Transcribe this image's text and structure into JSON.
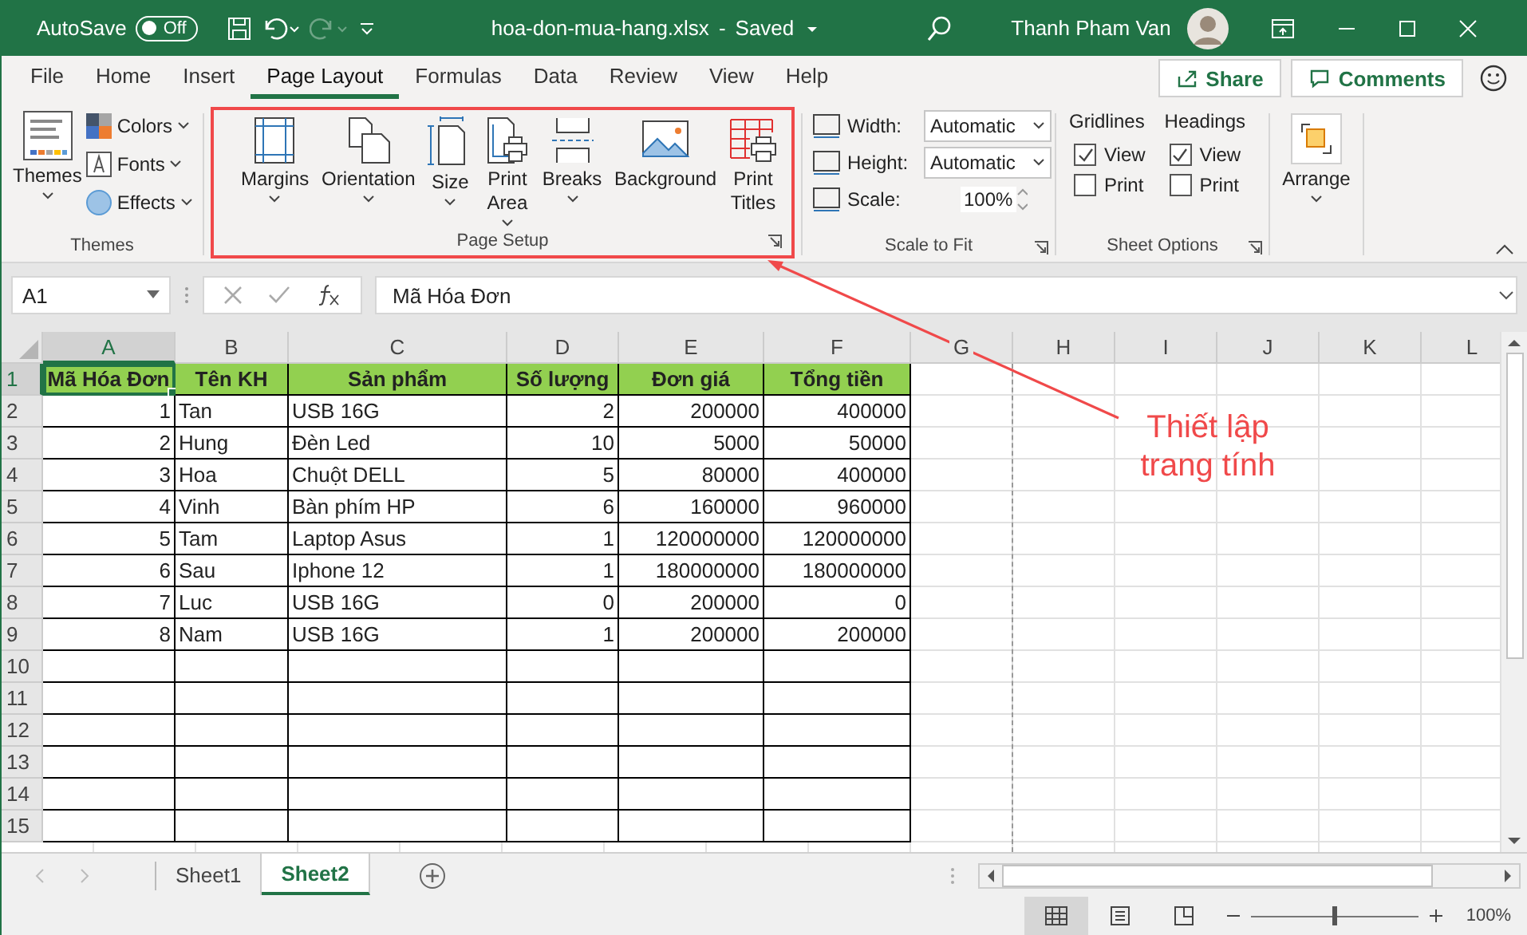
{
  "title_bar": {
    "autosave_label": "AutoSave",
    "autosave": {
      "label": "Off",
      "on": false
    },
    "file_name": "hoa-don-mua-hang.xlsx",
    "separator": "-",
    "save_status": "Saved",
    "user_name": "Thanh Pham Van"
  },
  "tabs": [
    {
      "label": "File",
      "selected": false
    },
    {
      "label": "Home",
      "selected": false
    },
    {
      "label": "Insert",
      "selected": false
    },
    {
      "label": "Page Layout",
      "selected": true
    },
    {
      "label": "Formulas",
      "selected": false
    },
    {
      "label": "Data",
      "selected": false
    },
    {
      "label": "Review",
      "selected": false
    },
    {
      "label": "View",
      "selected": false
    },
    {
      "label": "Help",
      "selected": false
    }
  ],
  "share": "Share",
  "comments": "Comments",
  "ribbon": {
    "themes": {
      "title": "Themes",
      "button": "Themes",
      "items": [
        {
          "label": "Colors",
          "kind": "colors"
        },
        {
          "label": "Fonts",
          "kind": "fonts"
        },
        {
          "label": "Effects",
          "kind": "effects"
        }
      ]
    },
    "page_setup": {
      "title": "Page Setup",
      "highlighted": true,
      "buttons": [
        {
          "label": "Margins",
          "kind": "margins",
          "dropdown": true
        },
        {
          "label": "Orientation",
          "kind": "orientation",
          "dropdown": true
        },
        {
          "label": "Size",
          "kind": "size",
          "dropdown": true
        },
        {
          "label": "Print Area",
          "kind": "print-area",
          "dropdown": true
        },
        {
          "label": "Breaks",
          "kind": "breaks",
          "dropdown": true
        },
        {
          "label": "Background",
          "kind": "background",
          "dropdown": false
        },
        {
          "label": "Print Titles",
          "kind": "print-titles",
          "dropdown": false
        }
      ]
    },
    "scale_to_fit": {
      "title": "Scale to Fit",
      "rows": [
        {
          "label": "Width:",
          "value": "Automatic",
          "kind": "dropdown"
        },
        {
          "label": "Height:",
          "value": "Automatic",
          "kind": "dropdown"
        },
        {
          "label": "Scale:",
          "value": "100%",
          "kind": "spinner"
        }
      ]
    },
    "sheet_options": {
      "title": "Sheet Options",
      "columns": [
        {
          "title": "Gridlines",
          "options": [
            {
              "label": "View",
              "checked": true
            },
            {
              "label": "Print",
              "checked": false
            }
          ]
        },
        {
          "title": "Headings",
          "options": [
            {
              "label": "View",
              "checked": true
            },
            {
              "label": "Print",
              "checked": false
            }
          ]
        }
      ]
    },
    "arrange": {
      "label": "Arrange"
    }
  },
  "formula_bar": {
    "name_box": "A1",
    "content": "Mã Hóa Đơn"
  },
  "sheet": {
    "columns": [
      {
        "letter": "A",
        "selected": true,
        "kind": "number",
        "page_break": false
      },
      {
        "letter": "B",
        "selected": false,
        "kind": "text",
        "page_break": false
      },
      {
        "letter": "C",
        "selected": false,
        "kind": "text",
        "page_break": false
      },
      {
        "letter": "D",
        "selected": false,
        "kind": "number",
        "page_break": false
      },
      {
        "letter": "E",
        "selected": false,
        "kind": "number",
        "page_break": false
      },
      {
        "letter": "F",
        "selected": false,
        "kind": "number",
        "page_break": false
      },
      {
        "letter": "G",
        "selected": false,
        "page_break": false
      },
      {
        "letter": "H",
        "selected": false,
        "page_break": true
      },
      {
        "letter": "I",
        "selected": false,
        "page_break": false
      },
      {
        "letter": "J",
        "selected": false,
        "page_break": false
      },
      {
        "letter": "K",
        "selected": false,
        "page_break": false
      },
      {
        "letter": "L",
        "selected": false,
        "page_break": false
      }
    ],
    "rows": [
      {
        "number": "1",
        "selected": true,
        "kind": "header",
        "cells": [
          "Mã Hóa Đơn",
          "Tên KH",
          "Sản phẩm",
          "Số lượng",
          "Đơn giá",
          "Tổng tiền"
        ]
      },
      {
        "number": "2",
        "selected": false,
        "kind": "data",
        "cells": [
          "1",
          "Tan",
          "USB 16G",
          "2",
          "200000",
          "400000"
        ]
      },
      {
        "number": "3",
        "selected": false,
        "kind": "data",
        "cells": [
          "2",
          "Hung",
          "Đèn Led",
          "10",
          "5000",
          "50000"
        ]
      },
      {
        "number": "4",
        "selected": false,
        "kind": "data",
        "cells": [
          "3",
          "Hoa",
          "Chuột DELL",
          "5",
          "80000",
          "400000"
        ]
      },
      {
        "number": "5",
        "selected": false,
        "kind": "data",
        "cells": [
          "4",
          "Vinh",
          "Bàn phím HP",
          "6",
          "160000",
          "960000"
        ]
      },
      {
        "number": "6",
        "selected": false,
        "kind": "data",
        "cells": [
          "5",
          "Tam",
          "Laptop Asus",
          "1",
          "120000000",
          "120000000"
        ]
      },
      {
        "number": "7",
        "selected": false,
        "kind": "data",
        "cells": [
          "6",
          "Sau",
          "Iphone 12",
          "1",
          "180000000",
          "180000000"
        ]
      },
      {
        "number": "8",
        "selected": false,
        "kind": "data",
        "cells": [
          "7",
          "Luc",
          "USB 16G",
          "0",
          "200000",
          "0"
        ]
      },
      {
        "number": "9",
        "selected": false,
        "kind": "data",
        "cells": [
          "8",
          "Nam",
          "USB 16G",
          "1",
          "200000",
          "200000"
        ]
      },
      {
        "number": "10",
        "selected": false,
        "kind": "data"
      },
      {
        "number": "11",
        "selected": false,
        "kind": "data"
      },
      {
        "number": "12",
        "selected": false,
        "kind": "data"
      },
      {
        "number": "13",
        "selected": false,
        "kind": "data"
      },
      {
        "number": "14",
        "selected": false,
        "kind": "data"
      },
      {
        "number": "15",
        "selected": false,
        "kind": "data"
      }
    ]
  },
  "sheet_tabs": [
    {
      "label": "Sheet1",
      "selected": false
    },
    {
      "label": "Sheet2",
      "selected": true
    }
  ],
  "status_bar": {
    "views": [
      {
        "kind": "normal",
        "selected": true
      },
      {
        "kind": "page-layout",
        "selected": false
      },
      {
        "kind": "page-break",
        "selected": false
      }
    ],
    "zoom_slider": {
      "level": 0.5
    },
    "zoom": "100%"
  },
  "annotation": {
    "text": "Thiết lập trang tính"
  }
}
